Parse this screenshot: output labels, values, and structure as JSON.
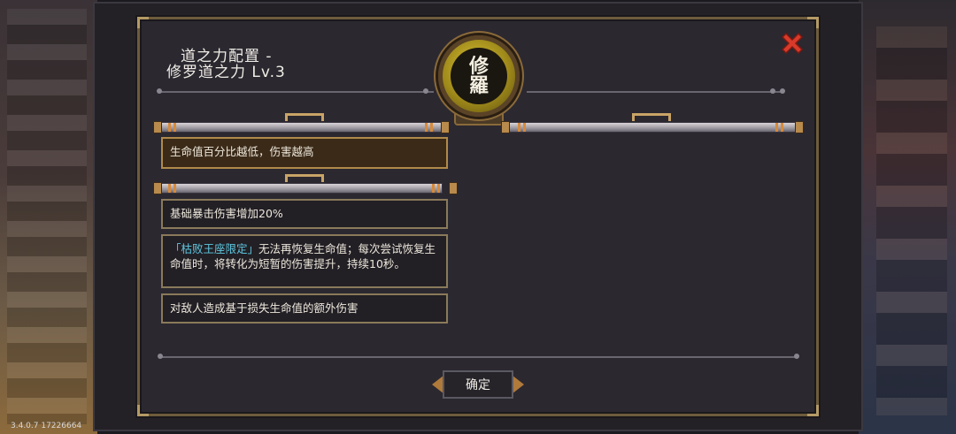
{
  "dialog": {
    "title_line1": "道之力配置 -",
    "title_line2": "修罗道之力 Lv.3",
    "emblem_text_top": "修",
    "emblem_text_bottom": "羅",
    "confirm_label": "确定"
  },
  "entries": [
    {
      "text": "生命值百分比越低，伤害越高",
      "active": true
    },
    {
      "text": "基础暴击伤害增加20%",
      "active": false
    },
    {
      "highlight": "「枯败王座限定」",
      "text": "无法再恢复生命值；每次尝试恢复生命值时，将转化为短暂的伤害提升，持续10秒。",
      "active": false
    },
    {
      "text": "对敌人造成基于损失生命值的额外伤害",
      "active": false
    }
  ],
  "version": "3.4.0.7 17226664",
  "colors": {
    "panel_bg": "#2b2830",
    "border_gold": "#6e5c3c",
    "active_entry_bg": "#3b2a18",
    "highlight_cyan": "#5ec8e0",
    "close_red": "#d83a2a",
    "emblem_gold": "#c9b02a"
  },
  "icons": {
    "close": "close-x-icon",
    "emblem": "shura-emblem-icon"
  }
}
